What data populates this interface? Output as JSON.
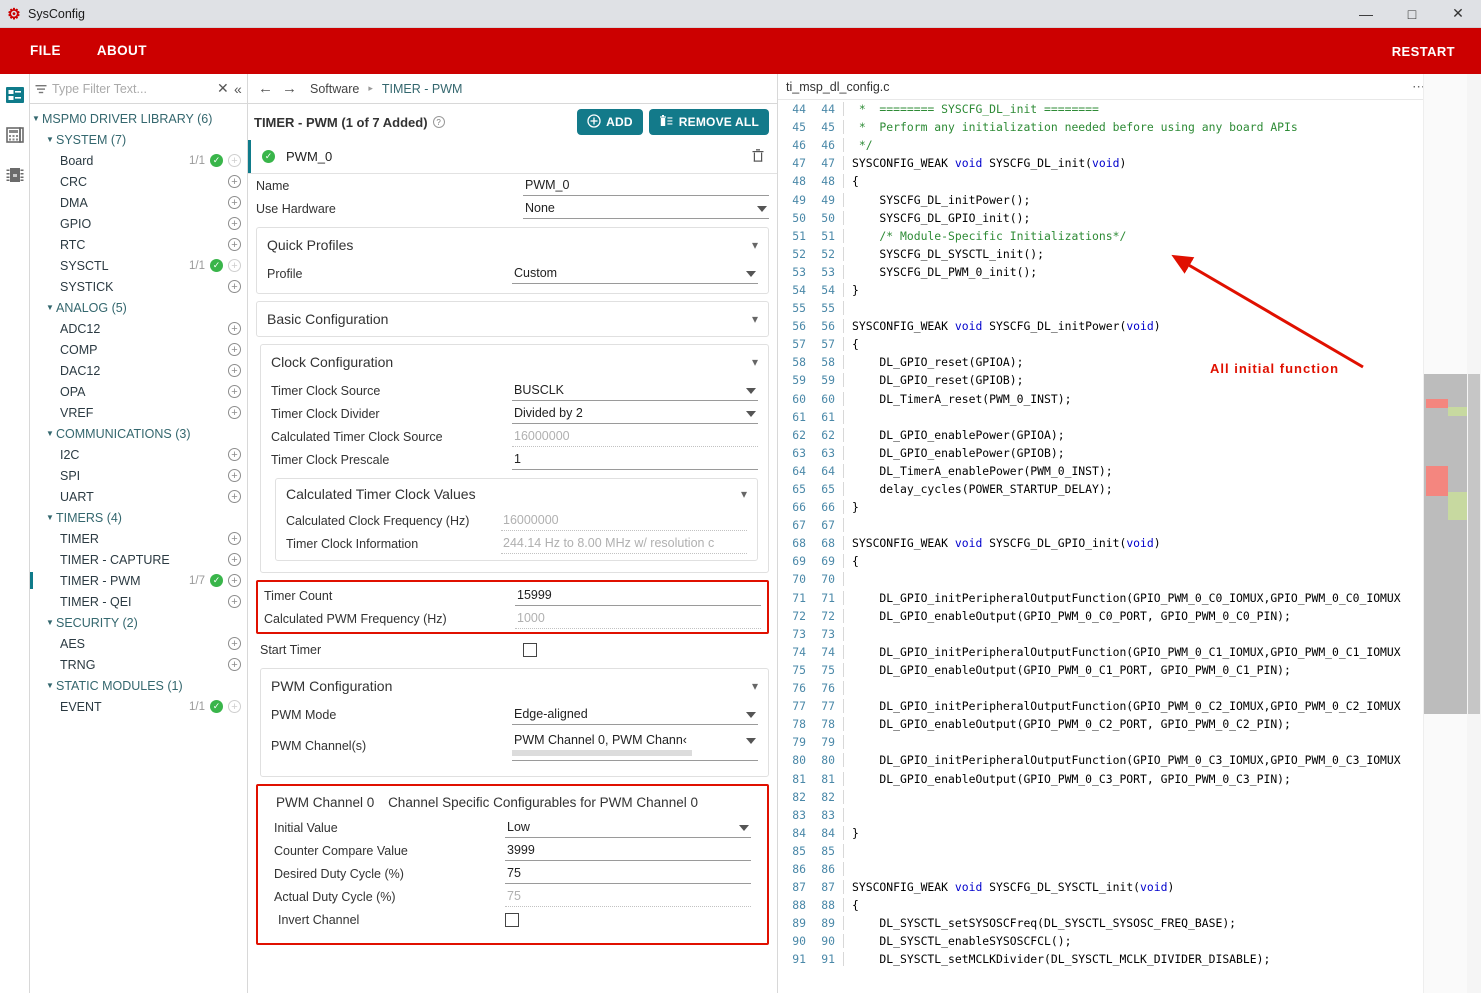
{
  "window": {
    "title": "SysConfig",
    "app_icon": "sysconfig-logo-icon",
    "minimize": "—",
    "maximize": "□",
    "close": "✕"
  },
  "menubar": {
    "items": [
      {
        "label": "FILE"
      },
      {
        "label": "ABOUT"
      }
    ],
    "restart_label": "RESTART"
  },
  "rail": {
    "icons": [
      {
        "name": "software-config-icon",
        "selected": true
      },
      {
        "name": "board-view-icon",
        "selected": false
      },
      {
        "name": "chip-view-icon",
        "selected": false
      }
    ]
  },
  "sidebar": {
    "filter": {
      "placeholder": "Type Filter Text...",
      "value": "",
      "filter_icon": "filter-icon",
      "clear_icon": "clear-x-icon",
      "collapse_icon": "collapse-all-icon"
    },
    "tree": [
      {
        "level": 0,
        "label": "MSPM0 DRIVER LIBRARY (6)",
        "type": "group",
        "expanded": true
      },
      {
        "level": 1,
        "label": "SYSTEM (7)",
        "type": "group",
        "expanded": true
      },
      {
        "level": 2,
        "label": "Board",
        "count": "1/1",
        "check": true,
        "plus": "dim"
      },
      {
        "level": 2,
        "label": "CRC",
        "count": "",
        "check": false,
        "plus": "on"
      },
      {
        "level": 2,
        "label": "DMA",
        "count": "",
        "check": false,
        "plus": "on"
      },
      {
        "level": 2,
        "label": "GPIO",
        "count": "",
        "check": false,
        "plus": "on"
      },
      {
        "level": 2,
        "label": "RTC",
        "count": "",
        "check": false,
        "plus": "on"
      },
      {
        "level": 2,
        "label": "SYSCTL",
        "count": "1/1",
        "check": true,
        "plus": "dim"
      },
      {
        "level": 2,
        "label": "SYSTICK",
        "count": "",
        "check": false,
        "plus": "on"
      },
      {
        "level": 1,
        "label": "ANALOG (5)",
        "type": "group",
        "expanded": true
      },
      {
        "level": 2,
        "label": "ADC12",
        "count": "",
        "check": false,
        "plus": "on"
      },
      {
        "level": 2,
        "label": "COMP",
        "count": "",
        "check": false,
        "plus": "on"
      },
      {
        "level": 2,
        "label": "DAC12",
        "count": "",
        "check": false,
        "plus": "on"
      },
      {
        "level": 2,
        "label": "OPA",
        "count": "",
        "check": false,
        "plus": "on"
      },
      {
        "level": 2,
        "label": "VREF",
        "count": "",
        "check": false,
        "plus": "on"
      },
      {
        "level": 1,
        "label": "COMMUNICATIONS (3)",
        "type": "group",
        "expanded": true
      },
      {
        "level": 2,
        "label": "I2C",
        "count": "",
        "check": false,
        "plus": "on"
      },
      {
        "level": 2,
        "label": "SPI",
        "count": "",
        "check": false,
        "plus": "on"
      },
      {
        "level": 2,
        "label": "UART",
        "count": "",
        "check": false,
        "plus": "on"
      },
      {
        "level": 1,
        "label": "TIMERS (4)",
        "type": "group",
        "expanded": true
      },
      {
        "level": 2,
        "label": "TIMER",
        "count": "",
        "check": false,
        "plus": "on"
      },
      {
        "level": 2,
        "label": "TIMER - CAPTURE",
        "count": "",
        "check": false,
        "plus": "on"
      },
      {
        "level": 2,
        "label": "TIMER - PWM",
        "count": "1/7",
        "check": true,
        "plus": "on",
        "selected": true
      },
      {
        "level": 2,
        "label": "TIMER - QEI",
        "count": "",
        "check": false,
        "plus": "on"
      },
      {
        "level": 1,
        "label": "SECURITY (2)",
        "type": "group",
        "expanded": true
      },
      {
        "level": 2,
        "label": "AES",
        "count": "",
        "check": false,
        "plus": "on"
      },
      {
        "level": 2,
        "label": "TRNG",
        "count": "",
        "check": false,
        "plus": "on"
      },
      {
        "level": 1,
        "label": "STATIC MODULES (1)",
        "type": "group",
        "expanded": true
      },
      {
        "level": 2,
        "label": "EVENT",
        "count": "1/1",
        "check": true,
        "plus": "dim"
      }
    ]
  },
  "breadcrumb": {
    "back_icon": "arrow-left-icon",
    "forward_icon": "arrow-right-icon",
    "items": [
      "Software",
      "TIMER - PWM"
    ],
    "separator": "▸"
  },
  "config": {
    "header": {
      "title": "TIMER - PWM (1 of 7 Added)",
      "help_icon": "help-circle-icon",
      "add_label": "ADD",
      "remove_all_label": "REMOVE ALL"
    },
    "instance": {
      "name": "PWM_0",
      "status_icon": "check-circle-icon",
      "delete_icon": "trash-icon"
    },
    "fields": {
      "name_label": "Name",
      "name_value": "PWM_0",
      "use_hardware_label": "Use Hardware",
      "use_hardware_value": "None"
    },
    "quick_profiles": {
      "title": "Quick Profiles",
      "profile_label": "Profile",
      "profile_value": "Custom"
    },
    "basic_configuration": {
      "title": "Basic Configuration"
    },
    "clock_configuration": {
      "title": "Clock Configuration",
      "rows": [
        {
          "label": "Timer Clock Source",
          "value": "BUSCLK",
          "kind": "dropdown"
        },
        {
          "label": "Timer Clock Divider",
          "value": "Divided by 2",
          "kind": "dropdown"
        },
        {
          "label": "Calculated Timer Clock Source",
          "value": "16000000",
          "kind": "readonly"
        },
        {
          "label": "Timer Clock Prescale",
          "value": "1",
          "kind": "text"
        }
      ]
    },
    "calculated_timer_clock_values": {
      "title": "Calculated Timer Clock Values",
      "rows": [
        {
          "label": "Calculated Clock Frequency (Hz)",
          "value": "16000000",
          "kind": "readonly"
        },
        {
          "label": "Timer Clock Information",
          "value": "244.14 Hz to 8.00 MHz w/ resolution c",
          "kind": "readonly"
        }
      ]
    },
    "timer_count_group": {
      "rows": [
        {
          "label": "Timer Count",
          "value": "15999",
          "kind": "text"
        },
        {
          "label": "Calculated PWM Frequency (Hz)",
          "value": "1000",
          "kind": "readonly"
        }
      ]
    },
    "start_timer": {
      "label": "Start Timer",
      "checked": false
    },
    "pwm_configuration": {
      "title": "PWM Configuration",
      "mode_label": "PWM Mode",
      "mode_value": "Edge-aligned",
      "channels_label": "PWM Channel(s)",
      "channels_value": "PWM Channel 0, PWM Chann‹"
    },
    "pwm_channel_0": {
      "title": "PWM Channel 0",
      "subtitle": "Channel Specific Configurables for PWM Channel 0",
      "rows": [
        {
          "label": "Initial Value",
          "value": "Low",
          "kind": "dropdown"
        },
        {
          "label": "Counter Compare Value",
          "value": "3999",
          "kind": "text"
        },
        {
          "label": "Desired Duty Cycle (%)",
          "value": "75",
          "kind": "text"
        },
        {
          "label": "Actual Duty Cycle (%)",
          "value": "75",
          "kind": "readonly"
        }
      ],
      "invert_label": "Invert Channel",
      "invert_checked": false
    }
  },
  "code_panel": {
    "filename": "ti_msp_dl_config.c",
    "more_icon": "more-horizontal-icon",
    "save_icon": "save-disk-icon",
    "close_icon": "close-x-icon",
    "lines": [
      {
        "n": 44,
        "segs": [
          {
            "t": " *  ======== SYSCFG_DL_init ========",
            "c": "cmt"
          }
        ]
      },
      {
        "n": 45,
        "segs": [
          {
            "t": " *  Perform any initialization needed before using any board APIs",
            "c": "cmt"
          }
        ]
      },
      {
        "n": 46,
        "segs": [
          {
            "t": " */",
            "c": "cmt"
          }
        ]
      },
      {
        "n": 47,
        "segs": [
          {
            "t": "SYSCONFIG_WEAK ",
            "c": ""
          },
          {
            "t": "void",
            "c": "kw"
          },
          {
            "t": " SYSCFG_DL_init(",
            "c": ""
          },
          {
            "t": "void",
            "c": "kw"
          },
          {
            "t": ")",
            "c": ""
          }
        ]
      },
      {
        "n": 48,
        "segs": [
          {
            "t": "{",
            "c": ""
          }
        ]
      },
      {
        "n": 49,
        "segs": [
          {
            "t": "    SYSCFG_DL_initPower();",
            "c": ""
          }
        ]
      },
      {
        "n": 50,
        "segs": [
          {
            "t": "    SYSCFG_DL_GPIO_init();",
            "c": ""
          }
        ]
      },
      {
        "n": 51,
        "segs": [
          {
            "t": "    /* Module-Specific Initializations*/",
            "c": "cmt"
          }
        ]
      },
      {
        "n": 52,
        "segs": [
          {
            "t": "    SYSCFG_DL_SYSCTL_init();",
            "c": ""
          }
        ]
      },
      {
        "n": 53,
        "segs": [
          {
            "t": "    SYSCFG_DL_PWM_0_init();",
            "c": ""
          }
        ]
      },
      {
        "n": 54,
        "segs": [
          {
            "t": "}",
            "c": ""
          }
        ]
      },
      {
        "n": 55,
        "segs": [
          {
            "t": "",
            "c": ""
          }
        ]
      },
      {
        "n": 56,
        "segs": [
          {
            "t": "SYSCONFIG_WEAK ",
            "c": ""
          },
          {
            "t": "void",
            "c": "kw"
          },
          {
            "t": " SYSCFG_DL_initPower(",
            "c": ""
          },
          {
            "t": "void",
            "c": "kw"
          },
          {
            "t": ")",
            "c": ""
          }
        ]
      },
      {
        "n": 57,
        "segs": [
          {
            "t": "{",
            "c": ""
          }
        ]
      },
      {
        "n": 58,
        "segs": [
          {
            "t": "    DL_GPIO_reset(GPIOA);",
            "c": ""
          }
        ]
      },
      {
        "n": 59,
        "segs": [
          {
            "t": "    DL_GPIO_reset(GPIOB);",
            "c": ""
          }
        ]
      },
      {
        "n": 60,
        "segs": [
          {
            "t": "    DL_TimerA_reset(PWM_0_INST);",
            "c": ""
          }
        ]
      },
      {
        "n": 61,
        "segs": [
          {
            "t": "",
            "c": ""
          }
        ]
      },
      {
        "n": 62,
        "segs": [
          {
            "t": "    DL_GPIO_enablePower(GPIOA);",
            "c": ""
          }
        ]
      },
      {
        "n": 63,
        "segs": [
          {
            "t": "    DL_GPIO_enablePower(GPIOB);",
            "c": ""
          }
        ]
      },
      {
        "n": 64,
        "segs": [
          {
            "t": "    DL_TimerA_enablePower(PWM_0_INST);",
            "c": ""
          }
        ]
      },
      {
        "n": 65,
        "segs": [
          {
            "t": "    delay_cycles(POWER_STARTUP_DELAY);",
            "c": ""
          }
        ]
      },
      {
        "n": 66,
        "segs": [
          {
            "t": "}",
            "c": ""
          }
        ]
      },
      {
        "n": 67,
        "segs": [
          {
            "t": "",
            "c": ""
          }
        ]
      },
      {
        "n": 68,
        "segs": [
          {
            "t": "SYSCONFIG_WEAK ",
            "c": ""
          },
          {
            "t": "void",
            "c": "kw"
          },
          {
            "t": " SYSCFG_DL_GPIO_init(",
            "c": ""
          },
          {
            "t": "void",
            "c": "kw"
          },
          {
            "t": ")",
            "c": ""
          }
        ]
      },
      {
        "n": 69,
        "segs": [
          {
            "t": "{",
            "c": ""
          }
        ]
      },
      {
        "n": 70,
        "segs": [
          {
            "t": "",
            "c": ""
          }
        ]
      },
      {
        "n": 71,
        "segs": [
          {
            "t": "    DL_GPIO_initPeripheralOutputFunction(GPIO_PWM_0_C0_IOMUX,GPIO_PWM_0_C0_IOMUX",
            "c": ""
          }
        ]
      },
      {
        "n": 72,
        "segs": [
          {
            "t": "    DL_GPIO_enableOutput(GPIO_PWM_0_C0_PORT, GPIO_PWM_0_C0_PIN);",
            "c": ""
          }
        ]
      },
      {
        "n": 73,
        "segs": [
          {
            "t": "",
            "c": ""
          }
        ]
      },
      {
        "n": 74,
        "segs": [
          {
            "t": "    DL_GPIO_initPeripheralOutputFunction(GPIO_PWM_0_C1_IOMUX,GPIO_PWM_0_C1_IOMUX",
            "c": ""
          }
        ]
      },
      {
        "n": 75,
        "segs": [
          {
            "t": "    DL_GPIO_enableOutput(GPIO_PWM_0_C1_PORT, GPIO_PWM_0_C1_PIN);",
            "c": ""
          }
        ]
      },
      {
        "n": 76,
        "segs": [
          {
            "t": "",
            "c": ""
          }
        ]
      },
      {
        "n": 77,
        "segs": [
          {
            "t": "    DL_GPIO_initPeripheralOutputFunction(GPIO_PWM_0_C2_IOMUX,GPIO_PWM_0_C2_IOMUX",
            "c": ""
          }
        ]
      },
      {
        "n": 78,
        "segs": [
          {
            "t": "    DL_GPIO_enableOutput(GPIO_PWM_0_C2_PORT, GPIO_PWM_0_C2_PIN);",
            "c": ""
          }
        ]
      },
      {
        "n": 79,
        "segs": [
          {
            "t": "",
            "c": ""
          }
        ]
      },
      {
        "n": 80,
        "segs": [
          {
            "t": "    DL_GPIO_initPeripheralOutputFunction(GPIO_PWM_0_C3_IOMUX,GPIO_PWM_0_C3_IOMUX",
            "c": ""
          }
        ]
      },
      {
        "n": 81,
        "segs": [
          {
            "t": "    DL_GPIO_enableOutput(GPIO_PWM_0_C3_PORT, GPIO_PWM_0_C3_PIN);",
            "c": ""
          }
        ]
      },
      {
        "n": 82,
        "segs": [
          {
            "t": "",
            "c": ""
          }
        ]
      },
      {
        "n": 83,
        "segs": [
          {
            "t": "",
            "c": ""
          }
        ]
      },
      {
        "n": 84,
        "segs": [
          {
            "t": "}",
            "c": ""
          }
        ]
      },
      {
        "n": 85,
        "segs": [
          {
            "t": "",
            "c": ""
          }
        ]
      },
      {
        "n": 86,
        "segs": [
          {
            "t": "",
            "c": ""
          }
        ]
      },
      {
        "n": 87,
        "segs": [
          {
            "t": "SYSCONFIG_WEAK ",
            "c": ""
          },
          {
            "t": "void",
            "c": "kw"
          },
          {
            "t": " SYSCFG_DL_SYSCTL_init(",
            "c": ""
          },
          {
            "t": "void",
            "c": "kw"
          },
          {
            "t": ")",
            "c": ""
          }
        ]
      },
      {
        "n": 88,
        "segs": [
          {
            "t": "{",
            "c": ""
          }
        ]
      },
      {
        "n": 89,
        "segs": [
          {
            "t": "    DL_SYSCTL_setSYSOSCFreq(DL_SYSCTL_SYSOSC_FREQ_BASE);",
            "c": ""
          }
        ]
      },
      {
        "n": 90,
        "segs": [
          {
            "t": "    DL_SYSCTL_enableSYSOSCFCL();",
            "c": ""
          }
        ]
      },
      {
        "n": 91,
        "segs": [
          {
            "t": "    DL_SYSCTL_setMCLKDivider(DL_SYSCTL_MCLK_DIVIDER_DISABLE);",
            "c": ""
          }
        ]
      }
    ]
  },
  "annotation": {
    "text": "All  initial  function",
    "color": "#e01000"
  },
  "colors": {
    "brand_red": "#cc0000",
    "teal": "#137a8a",
    "green_check": "#39b54a",
    "annotation_red": "#e01000",
    "titlebar": "#dfe1e5"
  }
}
